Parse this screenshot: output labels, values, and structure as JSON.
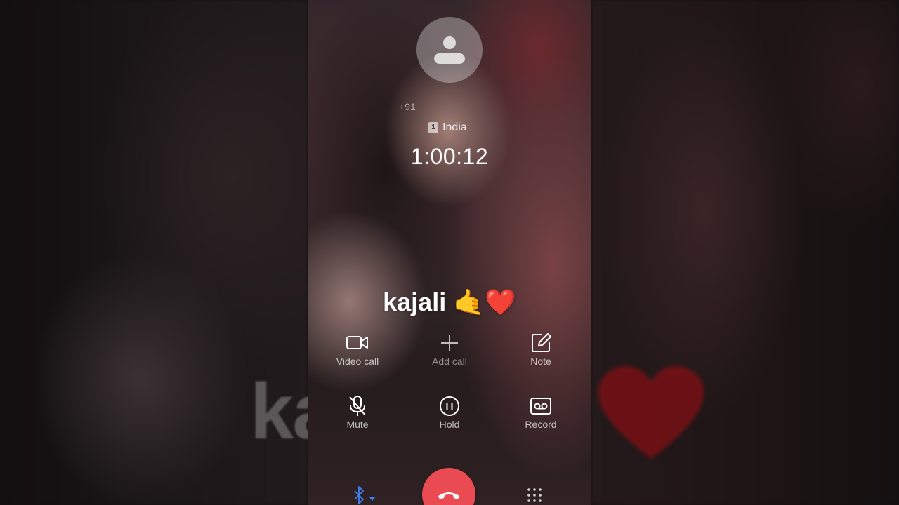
{
  "call": {
    "caller_number_prefix": "+91",
    "sim_slot": "1",
    "location": "India",
    "duration": "1:00:12"
  },
  "overlay": {
    "name": "kajali",
    "emojis": "🤙❤️",
    "heart_color": "#e8121c"
  },
  "controls": {
    "video_call": {
      "label": "Video call",
      "icon": "video-icon"
    },
    "add_call": {
      "label": "Add call",
      "icon": "plus-icon"
    },
    "note": {
      "label": "Note",
      "icon": "edit-icon"
    },
    "mute": {
      "label": "Mute",
      "icon": "microphone-off-icon"
    },
    "hold": {
      "label": "Hold",
      "icon": "pause-icon"
    },
    "record": {
      "label": "Record",
      "icon": "voicemail-icon"
    }
  },
  "bottom": {
    "audio_route_icon": "bluetooth-icon",
    "end_call_icon": "phone-hangup-icon",
    "keypad_icon": "dialpad-icon"
  },
  "colors": {
    "end_call": "#ea4a52",
    "bluetooth": "#3b82f6"
  }
}
